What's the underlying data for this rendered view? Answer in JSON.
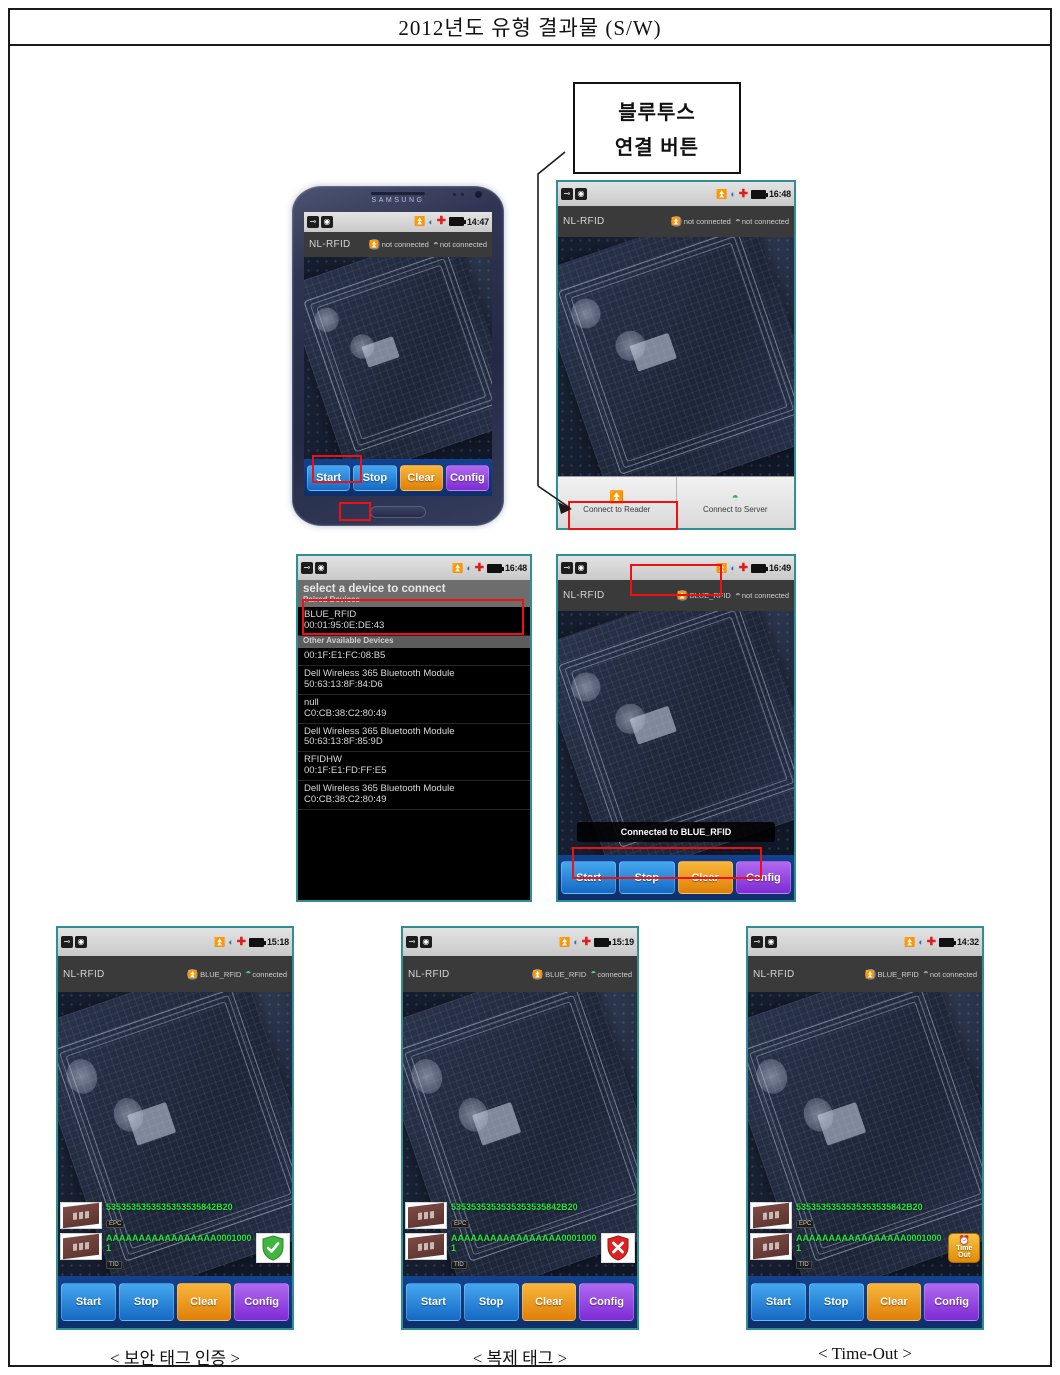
{
  "document": {
    "title": "2012년도 유형 결과물 (S/W)"
  },
  "callout": {
    "line1": "블루투스",
    "line2": "연결 버튼"
  },
  "phone_device": {
    "brand": "SAMSUNG"
  },
  "screens": {
    "main_on_device": {
      "statusbar": {
        "usb_icon": "usb-icon",
        "capture_icon": "screenshot-icon",
        "bt_icon": "bluetooth-icon",
        "wifi_icon": "wifi-icon",
        "cross_icon": "medical-cross-icon",
        "battery_icon": "battery-icon",
        "time": "14:47"
      },
      "appbar": {
        "app_name": "NL-RFID",
        "bt_label": "not connected",
        "wifi_label": "not connected",
        "wifi_connected": false
      },
      "buttons": [
        {
          "label": "Start",
          "color": "blue"
        },
        {
          "label": "Stop",
          "color": "blue"
        },
        {
          "label": "Clear",
          "color": "orange"
        },
        {
          "label": "Config",
          "color": "purple"
        }
      ]
    },
    "menu_open": {
      "statusbar": {
        "time": "16:48"
      },
      "appbar": {
        "app_name": "NL-RFID",
        "bt_label": "not connected",
        "wifi_label": "not connected",
        "wifi_connected": false
      },
      "menu_items": [
        {
          "label": "Connect to Reader",
          "icon": "bluetooth-icon"
        },
        {
          "label": "Connect to Server",
          "icon": "wifi-icon"
        }
      ]
    },
    "device_chooser": {
      "statusbar": {
        "time": "16:48"
      },
      "title": "select a device to connect",
      "paired_header": "Paired Devices",
      "other_header": "Other Available Devices",
      "paired_devices": [
        {
          "name": "BLUE_RFID",
          "mac": "00:01:95:0E:DE:43"
        }
      ],
      "other_devices": [
        {
          "name": "",
          "mac": "00:1F:E1:FC:08:B5"
        },
        {
          "name": "Dell Wireless 365 Bluetooth Module",
          "mac": "50:63:13:8F:84:D6"
        },
        {
          "name": "null",
          "mac": "C0:CB:38:C2:80:49"
        },
        {
          "name": "Dell Wireless 365 Bluetooth Module",
          "mac": "50:63:13:8F:85:9D"
        },
        {
          "name": "RFIDHW",
          "mac": "00:1F:E1:FD:FF:E5"
        },
        {
          "name": "Dell Wireless 365 Bluetooth Module",
          "mac": "C0:CB:38:C2:80:49"
        }
      ]
    },
    "connected": {
      "statusbar": {
        "time": "16:49"
      },
      "appbar": {
        "app_name": "NL-RFID",
        "bt_label": "BLUE_RFID",
        "wifi_label": "not connected",
        "wifi_connected": false
      },
      "toast": "Connected to BLUE_RFID",
      "buttons": [
        {
          "label": "Start",
          "color": "blue"
        },
        {
          "label": "Stop",
          "color": "blue"
        },
        {
          "label": "Clear",
          "color": "orange"
        },
        {
          "label": "Config",
          "color": "purple"
        }
      ]
    },
    "result_secure": {
      "statusbar": {
        "time": "15:18"
      },
      "appbar": {
        "app_name": "NL-RFID",
        "bt_label": "BLUE_RFID",
        "wifi_label": "connected",
        "wifi_connected": true
      },
      "rows": [
        {
          "id": "5353535353535353535842B20",
          "sub": "EPC"
        },
        {
          "id": "AAAAAAAAAAAAAAAAA00010001",
          "sub": "TID"
        }
      ],
      "status_icon": "shield-check-icon",
      "buttons": [
        {
          "label": "Start",
          "color": "blue"
        },
        {
          "label": "Stop",
          "color": "blue"
        },
        {
          "label": "Clear",
          "color": "orange"
        },
        {
          "label": "Config",
          "color": "purple"
        }
      ],
      "caption": "< 보안 태그 인증 >"
    },
    "result_clone": {
      "statusbar": {
        "time": "15:19"
      },
      "appbar": {
        "app_name": "NL-RFID",
        "bt_label": "BLUE_RFID",
        "wifi_label": "connected",
        "wifi_connected": true
      },
      "rows": [
        {
          "id": "5353535353535353535842B20",
          "sub": "EPC"
        },
        {
          "id": "AAAAAAAAAAAAAAAAA00010001",
          "sub": "TID"
        }
      ],
      "status_icon": "shield-x-icon",
      "buttons": [
        {
          "label": "Start",
          "color": "blue"
        },
        {
          "label": "Stop",
          "color": "blue"
        },
        {
          "label": "Clear",
          "color": "orange"
        },
        {
          "label": "Config",
          "color": "purple"
        }
      ],
      "caption": "< 복제 태그 >"
    },
    "result_timeout": {
      "statusbar": {
        "time": "14:32"
      },
      "appbar": {
        "app_name": "NL-RFID",
        "bt_label": "BLUE_RFID",
        "wifi_label": "not connected",
        "wifi_connected": false
      },
      "rows": [
        {
          "id": "5353535353535353535842B20",
          "sub": "EPC"
        },
        {
          "id": "AAAAAAAAAAAAAAAAA00010001",
          "sub": "TID"
        }
      ],
      "status_icon": "time-out-icon",
      "timeout_line1": "Time",
      "timeout_line2": "Out",
      "buttons": [
        {
          "label": "Start",
          "color": "blue"
        },
        {
          "label": "Stop",
          "color": "blue"
        },
        {
          "label": "Clear",
          "color": "orange"
        },
        {
          "label": "Config",
          "color": "purple"
        }
      ],
      "caption": "< Time-Out >"
    }
  },
  "colors": {
    "accent_blue": "#1569c4",
    "accent_orange": "#e07f08",
    "accent_purple": "#7e2bd4",
    "annotation_red": "#ee1111",
    "tag_green": "#25e53c"
  }
}
